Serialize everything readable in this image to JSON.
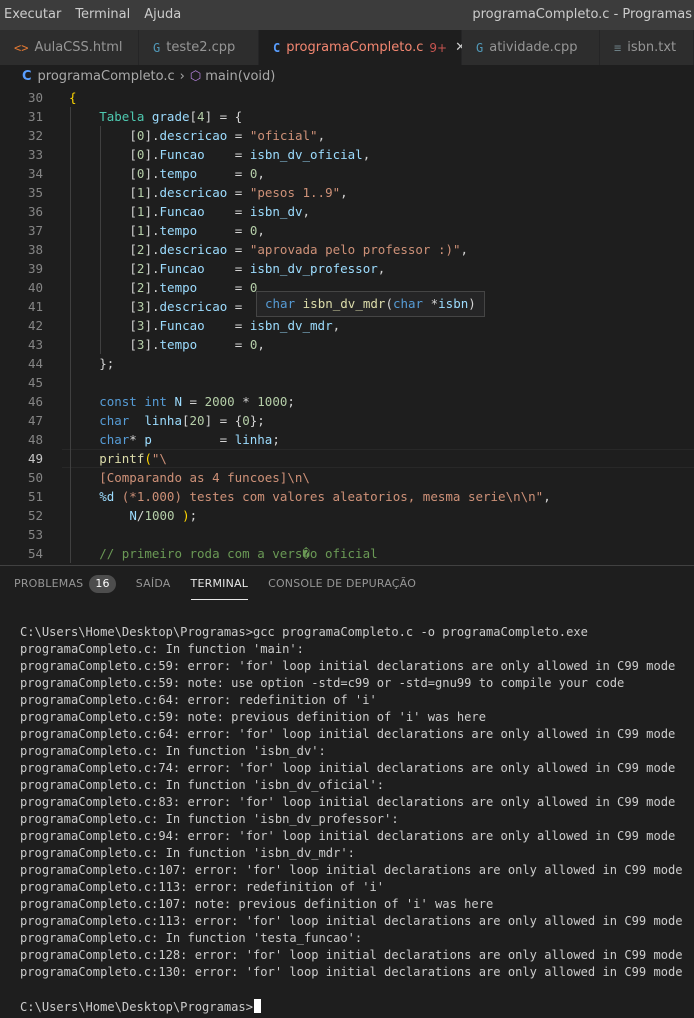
{
  "menu": {
    "items": [
      "Executar",
      "Terminal",
      "Ajuda"
    ],
    "window_title": "programaCompleto.c - Programas"
  },
  "tabs": [
    {
      "icon": "<>",
      "label": "AulaCSS.html",
      "kind": "html"
    },
    {
      "icon": "G",
      "label": "teste2.cpp",
      "kind": "cpp"
    },
    {
      "icon": "C",
      "label": "programaCompleto.c",
      "kind": "c",
      "modified": "9+",
      "active": true
    },
    {
      "icon": "G",
      "label": "atividade.cpp",
      "kind": "cpp"
    },
    {
      "icon": "≡",
      "label": "isbn.txt",
      "kind": "txt"
    }
  ],
  "breadcrumb": {
    "file": "programaCompleto.c",
    "symbol": "main(void)"
  },
  "editor": {
    "current_line": 49,
    "lines": [
      {
        "n": 30,
        "indent": 0,
        "tokens": [
          [
            "br",
            "{"
          ]
        ]
      },
      {
        "n": 31,
        "indent": 1,
        "tokens": [
          [
            "ty",
            "Tabela"
          ],
          [
            "pn",
            " "
          ],
          [
            "vr",
            "grade"
          ],
          [
            "pn",
            "["
          ],
          [
            "nu",
            "4"
          ],
          [
            "pn",
            "] = {"
          ]
        ]
      },
      {
        "n": 32,
        "indent": 2,
        "tokens": [
          [
            "pn",
            "["
          ],
          [
            "nu",
            "0"
          ],
          [
            "pn",
            "]."
          ],
          [
            "vr",
            "descricao"
          ],
          [
            "pn",
            " = "
          ],
          [
            "st",
            "\"oficial\""
          ],
          [
            "pn",
            ","
          ]
        ]
      },
      {
        "n": 33,
        "indent": 2,
        "tokens": [
          [
            "pn",
            "["
          ],
          [
            "nu",
            "0"
          ],
          [
            "pn",
            "]."
          ],
          [
            "vr",
            "Funcao"
          ],
          [
            "pn",
            "    = "
          ],
          [
            "vr",
            "isbn_dv_oficial"
          ],
          [
            "pn",
            ","
          ]
        ]
      },
      {
        "n": 34,
        "indent": 2,
        "tokens": [
          [
            "pn",
            "["
          ],
          [
            "nu",
            "0"
          ],
          [
            "pn",
            "]."
          ],
          [
            "vr",
            "tempo"
          ],
          [
            "pn",
            "     = "
          ],
          [
            "nu",
            "0"
          ],
          [
            "pn",
            ","
          ]
        ]
      },
      {
        "n": 35,
        "indent": 2,
        "tokens": [
          [
            "pn",
            "["
          ],
          [
            "nu",
            "1"
          ],
          [
            "pn",
            "]."
          ],
          [
            "vr",
            "descricao"
          ],
          [
            "pn",
            " = "
          ],
          [
            "st",
            "\"pesos 1..9\""
          ],
          [
            "pn",
            ","
          ]
        ]
      },
      {
        "n": 36,
        "indent": 2,
        "tokens": [
          [
            "pn",
            "["
          ],
          [
            "nu",
            "1"
          ],
          [
            "pn",
            "]."
          ],
          [
            "vr",
            "Funcao"
          ],
          [
            "pn",
            "    = "
          ],
          [
            "vr",
            "isbn_dv"
          ],
          [
            "pn",
            ","
          ]
        ]
      },
      {
        "n": 37,
        "indent": 2,
        "tokens": [
          [
            "pn",
            "["
          ],
          [
            "nu",
            "1"
          ],
          [
            "pn",
            "]."
          ],
          [
            "vr",
            "tempo"
          ],
          [
            "pn",
            "     = "
          ],
          [
            "nu",
            "0"
          ],
          [
            "pn",
            ","
          ]
        ]
      },
      {
        "n": 38,
        "indent": 2,
        "tokens": [
          [
            "pn",
            "["
          ],
          [
            "nu",
            "2"
          ],
          [
            "pn",
            "]."
          ],
          [
            "vr",
            "descricao"
          ],
          [
            "pn",
            " = "
          ],
          [
            "st",
            "\"aprovada pelo professor :)\""
          ],
          [
            "pn",
            ","
          ]
        ]
      },
      {
        "n": 39,
        "indent": 2,
        "tokens": [
          [
            "pn",
            "["
          ],
          [
            "nu",
            "2"
          ],
          [
            "pn",
            "]."
          ],
          [
            "vr",
            "Funcao"
          ],
          [
            "pn",
            "    = "
          ],
          [
            "vr",
            "isbn_dv_professor"
          ],
          [
            "pn",
            ","
          ]
        ]
      },
      {
        "n": 40,
        "indent": 2,
        "tokens": [
          [
            "pn",
            "["
          ],
          [
            "nu",
            "2"
          ],
          [
            "pn",
            "]."
          ],
          [
            "vr",
            "tempo"
          ],
          [
            "pn",
            "     = "
          ],
          [
            "nu",
            "0"
          ]
        ]
      },
      {
        "n": 41,
        "indent": 2,
        "tokens": [
          [
            "pn",
            "["
          ],
          [
            "nu",
            "3"
          ],
          [
            "pn",
            "]."
          ],
          [
            "vr",
            "descricao"
          ],
          [
            "pn",
            " ="
          ]
        ]
      },
      {
        "n": 42,
        "indent": 2,
        "tokens": [
          [
            "pn",
            "["
          ],
          [
            "nu",
            "3"
          ],
          [
            "pn",
            "]."
          ],
          [
            "vr",
            "Funcao"
          ],
          [
            "pn",
            "    = "
          ],
          [
            "vr",
            "isbn_dv_mdr"
          ],
          [
            "pn",
            ","
          ]
        ]
      },
      {
        "n": 43,
        "indent": 2,
        "tokens": [
          [
            "pn",
            "["
          ],
          [
            "nu",
            "3"
          ],
          [
            "pn",
            "]."
          ],
          [
            "vr",
            "tempo"
          ],
          [
            "pn",
            "     = "
          ],
          [
            "nu",
            "0"
          ],
          [
            "pn",
            ","
          ]
        ]
      },
      {
        "n": 44,
        "indent": 1,
        "tokens": [
          [
            "pn",
            "};"
          ]
        ]
      },
      {
        "n": 45,
        "indent": 0,
        "tokens": []
      },
      {
        "n": 46,
        "indent": 1,
        "tokens": [
          [
            "kw",
            "const"
          ],
          [
            "pn",
            " "
          ],
          [
            "kw",
            "int"
          ],
          [
            "pn",
            " "
          ],
          [
            "vr",
            "N"
          ],
          [
            "pn",
            " = "
          ],
          [
            "nu",
            "2000"
          ],
          [
            "pn",
            " * "
          ],
          [
            "nu",
            "1000"
          ],
          [
            "pn",
            ";"
          ]
        ]
      },
      {
        "n": 47,
        "indent": 1,
        "tokens": [
          [
            "kw",
            "char"
          ],
          [
            "pn",
            "  "
          ],
          [
            "vr",
            "linha"
          ],
          [
            "pn",
            "["
          ],
          [
            "nu",
            "20"
          ],
          [
            "pn",
            "] = {"
          ],
          [
            "nu",
            "0"
          ],
          [
            "pn",
            "};"
          ]
        ]
      },
      {
        "n": 48,
        "indent": 1,
        "tokens": [
          [
            "kw",
            "char"
          ],
          [
            "pn",
            "* "
          ],
          [
            "vr",
            "p"
          ],
          [
            "pn",
            "         = "
          ],
          [
            "vr",
            "linha"
          ],
          [
            "pn",
            ";"
          ]
        ]
      },
      {
        "n": 49,
        "indent": 1,
        "tokens": [
          [
            "fn",
            "printf"
          ],
          [
            "br",
            "("
          ],
          [
            "st",
            "\"\\"
          ]
        ]
      },
      {
        "n": 50,
        "indent": 1,
        "tokens": [
          [
            "st",
            "[Comparando as 4 funcoes]\\n\\"
          ]
        ]
      },
      {
        "n": 51,
        "indent": 1,
        "tokens": [
          [
            "vr",
            "%d"
          ],
          [
            "st",
            " (*1.000) testes com valores aleatorios, mesma serie\\n\\n\""
          ],
          [
            "pn",
            ","
          ]
        ]
      },
      {
        "n": 52,
        "indent": 2,
        "tokens": [
          [
            "vr",
            "N"
          ],
          [
            "pn",
            "/"
          ],
          [
            "nu",
            "1000"
          ],
          [
            "pn",
            " "
          ],
          [
            "br",
            ")"
          ],
          [
            "pn",
            ";"
          ]
        ]
      },
      {
        "n": 53,
        "indent": 0,
        "tokens": []
      },
      {
        "n": 54,
        "indent": 1,
        "tokens": [
          [
            "cm",
            "// primeiro roda com a vers�o oficial"
          ]
        ]
      }
    ],
    "hover_tokens": [
      [
        "kw",
        "char"
      ],
      [
        "pn",
        " "
      ],
      [
        "fn",
        "isbn_dv_mdr"
      ],
      [
        "pn",
        "("
      ],
      [
        "kw",
        "char"
      ],
      [
        "pn",
        " *"
      ],
      [
        "vr",
        "isbn"
      ],
      [
        "pn",
        ")"
      ]
    ]
  },
  "panel": {
    "tabs": [
      "PROBLEMAS",
      "SAÍDA",
      "TERMINAL",
      "CONSOLE DE DEPURAÇÃO"
    ],
    "problems_count": "16",
    "active_tab": "TERMINAL",
    "terminal_lines": [
      "C:\\Users\\Home\\Desktop\\Programas>gcc programaCompleto.c -o programaCompleto.exe",
      "programaCompleto.c: In function 'main':",
      "programaCompleto.c:59: error: 'for' loop initial declarations are only allowed in C99 mode",
      "programaCompleto.c:59: note: use option -std=c99 or -std=gnu99 to compile your code",
      "programaCompleto.c:64: error: redefinition of 'i'",
      "programaCompleto.c:59: note: previous definition of 'i' was here",
      "programaCompleto.c:64: error: 'for' loop initial declarations are only allowed in C99 mode",
      "programaCompleto.c: In function 'isbn_dv':",
      "programaCompleto.c:74: error: 'for' loop initial declarations are only allowed in C99 mode",
      "programaCompleto.c: In function 'isbn_dv_oficial':",
      "programaCompleto.c:83: error: 'for' loop initial declarations are only allowed in C99 mode",
      "programaCompleto.c: In function 'isbn_dv_professor':",
      "programaCompleto.c:94: error: 'for' loop initial declarations are only allowed in C99 mode",
      "programaCompleto.c: In function 'isbn_dv_mdr':",
      "programaCompleto.c:107: error: 'for' loop initial declarations are only allowed in C99 mode",
      "programaCompleto.c:113: error: redefinition of 'i'",
      "programaCompleto.c:107: note: previous definition of 'i' was here",
      "programaCompleto.c:113: error: 'for' loop initial declarations are only allowed in C99 mode",
      "programaCompleto.c: In function 'testa_funcao':",
      "programaCompleto.c:128: error: 'for' loop initial declarations are only allowed in C99 mode",
      "programaCompleto.c:130: error: 'for' loop initial declarations are only allowed in C99 mode"
    ],
    "prompt": "C:\\Users\\Home\\Desktop\\Programas>"
  }
}
